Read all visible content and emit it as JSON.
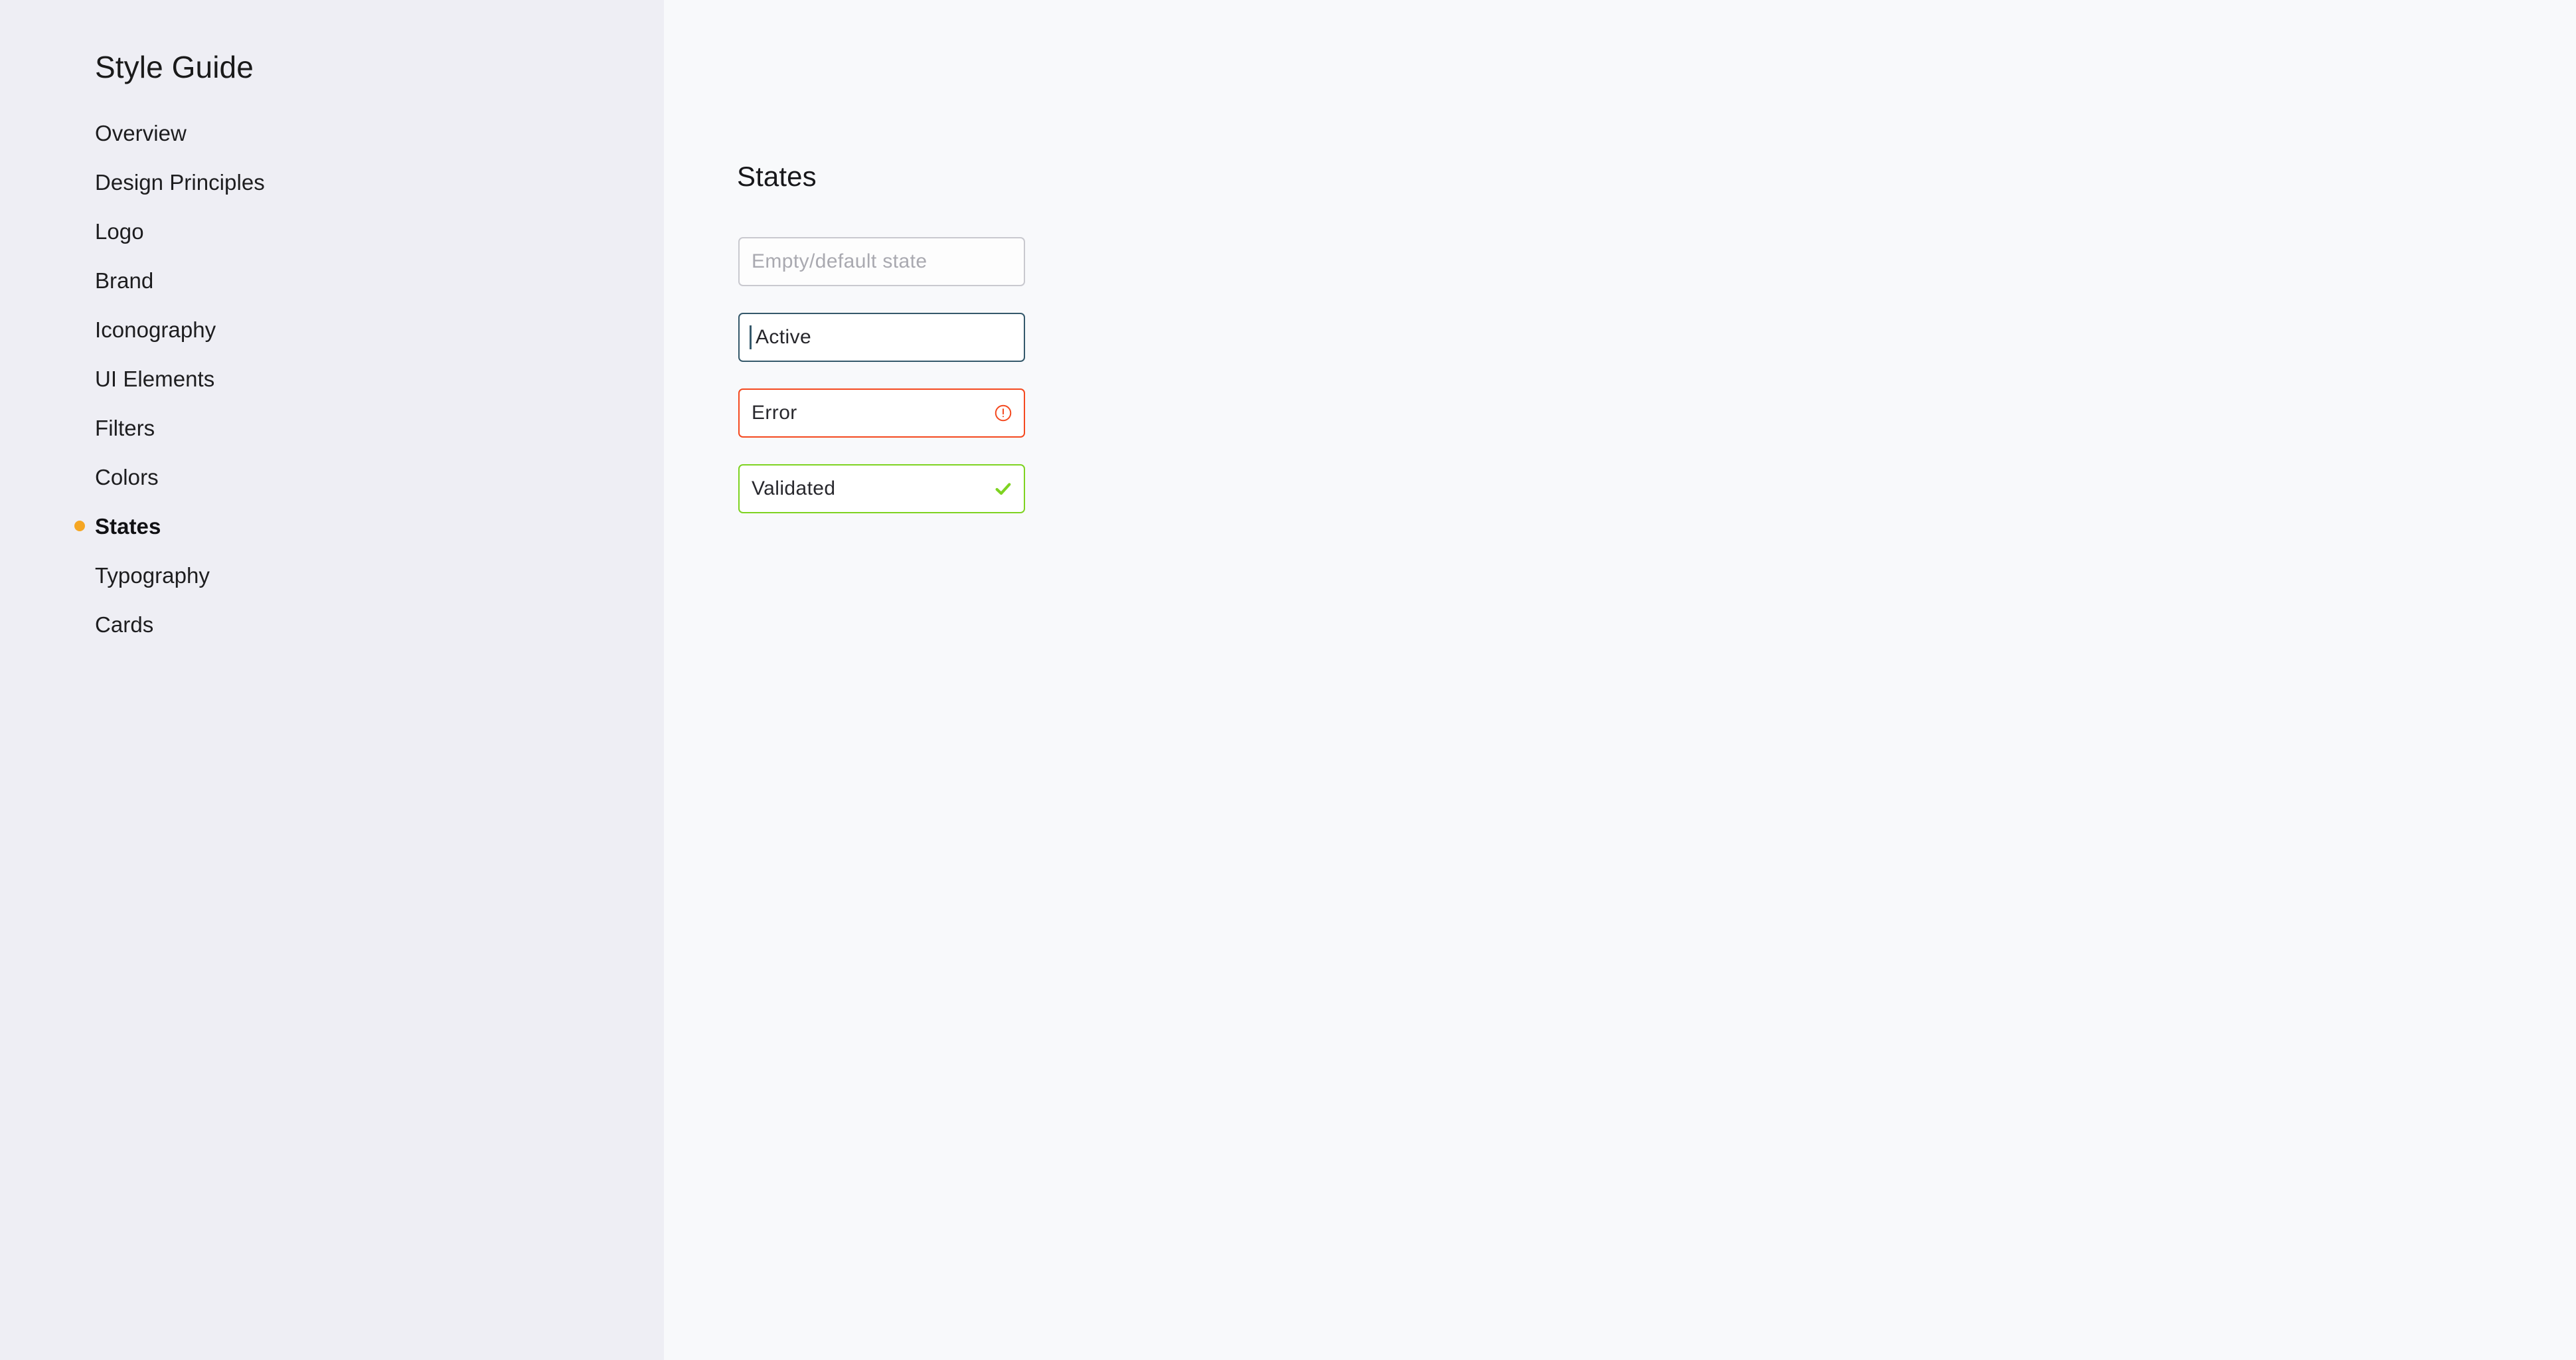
{
  "sidebar": {
    "title": "Style Guide",
    "items": [
      {
        "label": "Overview",
        "active": false
      },
      {
        "label": "Design Principles",
        "active": false
      },
      {
        "label": "Logo",
        "active": false
      },
      {
        "label": "Brand",
        "active": false
      },
      {
        "label": "Iconography",
        "active": false
      },
      {
        "label": "UI Elements",
        "active": false
      },
      {
        "label": "Filters",
        "active": false
      },
      {
        "label": "Colors",
        "active": false
      },
      {
        "label": "States",
        "active": true
      },
      {
        "label": "Typography",
        "active": false
      },
      {
        "label": "Cards",
        "active": false
      }
    ],
    "active_bullet_color": "#f5a623",
    "background_color": "#eeeef4"
  },
  "main": {
    "section_title": "States",
    "background_color": "#f8f9fb",
    "states": [
      {
        "id": "default",
        "placeholder": "Empty/default state",
        "value": "",
        "border_color": "#c9c9cf",
        "icon": "none",
        "caret": false
      },
      {
        "id": "active",
        "placeholder": "",
        "value": "Active",
        "border_color": "#35596b",
        "icon": "none",
        "caret": true
      },
      {
        "id": "error",
        "placeholder": "",
        "value": "Error",
        "border_color": "#f4491f",
        "icon": "exclamation-circle-icon",
        "icon_color": "#f4491f",
        "caret": false
      },
      {
        "id": "validated",
        "placeholder": "",
        "value": "Validated",
        "border_color": "#7ed321",
        "icon": "check-icon",
        "icon_color": "#7ed321",
        "caret": false
      }
    ]
  }
}
